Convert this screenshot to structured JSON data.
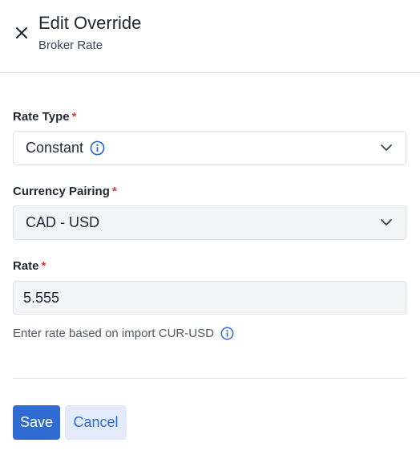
{
  "header": {
    "title": "Edit Override",
    "subtitle": "Broker Rate",
    "close_icon": "close-icon"
  },
  "form": {
    "rate_type": {
      "label": "Rate Type",
      "required_mark": "*",
      "value": "Constant",
      "info_icon": "info-icon"
    },
    "currency_pairing": {
      "label": "Currency Pairing",
      "required_mark": "*",
      "value": "CAD - USD",
      "disabled": true
    },
    "rate": {
      "label": "Rate",
      "required_mark": "*",
      "value": "5.555",
      "helper_text": "Enter rate based on import CUR-USD",
      "info_icon": "info-icon"
    }
  },
  "actions": {
    "save_label": "Save",
    "cancel_label": "Cancel"
  },
  "colors": {
    "primary": "#2f6bd1",
    "secondary_bg": "#e3ebfa",
    "required": "#d23a3a",
    "disabled_field_bg": "#f3f4f6"
  }
}
